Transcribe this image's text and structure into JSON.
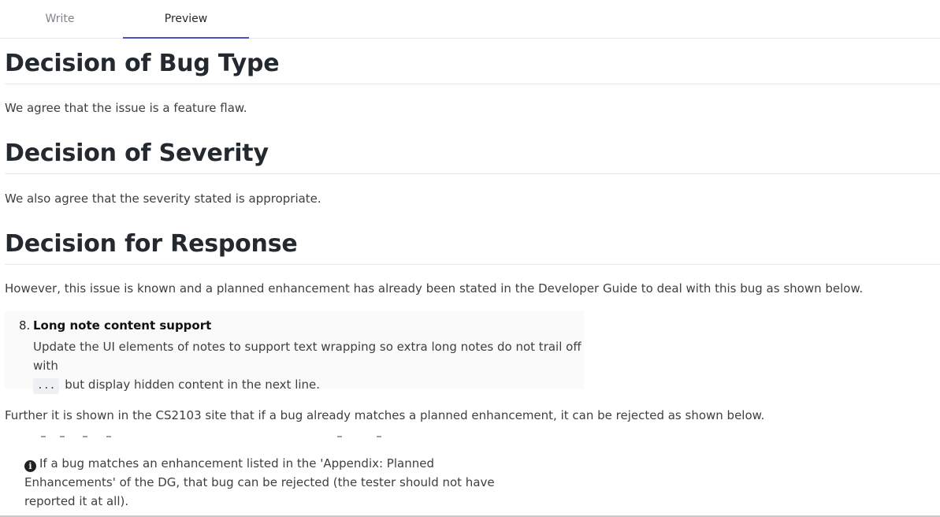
{
  "tabs": {
    "write": "Write",
    "preview": "Preview"
  },
  "sections": [
    {
      "heading": "Decision of Bug Type",
      "text": "We agree that the issue is a feature flaw."
    },
    {
      "heading": "Decision of Severity",
      "text": "We also agree that the severity stated is appropriate."
    },
    {
      "heading": "Decision for Response",
      "text": "However, this issue is known and a planned enhancement has already been stated in the Developer Guide to deal with this bug as shown below."
    }
  ],
  "note": {
    "number": "8.",
    "title": "Long note content support",
    "line1": "Update the UI elements of notes to support text wrapping so extra long notes do not trail off with",
    "code": "...",
    "line2": " but display hidden content in the next line."
  },
  "further": "Further it is shown in the CS2103 site that if a bug already matches a planned enhancement, it can be rejected as shown below.",
  "callout": {
    "icon": "info-icon",
    "text": "If a bug matches an enhancement listed in the 'Appendix: Planned Enhancements' of the DG, that bug can be rejected (the tester should not have reported it at all)."
  }
}
